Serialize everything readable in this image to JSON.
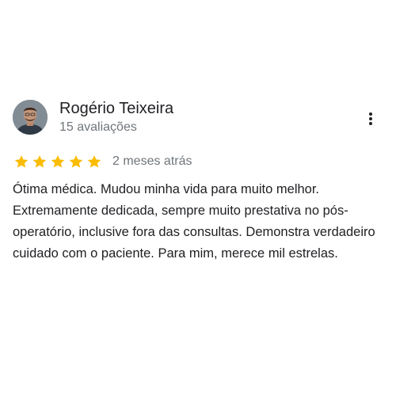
{
  "review": {
    "reviewer": {
      "name": "Rogério Teixeira",
      "meta": "15 avaliações",
      "avatar_icon": "person-avatar"
    },
    "more_icon": "more-vert-icon",
    "rating": {
      "value": 5,
      "max": 5,
      "star_color": "#fbbc04"
    },
    "date": "2 meses atrás",
    "text": "Ótima médica. Mudou minha vida para muito melhor. Extremamente dedicada, sempre muito prestativa no pós-operatório, inclusive fora das consultas. Demonstra verdadeiro cuidado com o paciente. Para mim, merece mil estrelas."
  }
}
